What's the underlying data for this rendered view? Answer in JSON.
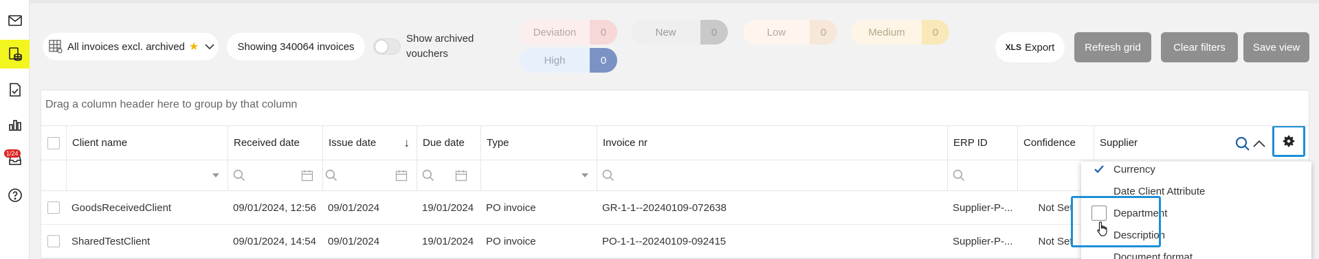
{
  "sidebar": {
    "items": [
      {
        "icon": "mail-icon"
      },
      {
        "icon": "invoices-database-icon",
        "active": true
      },
      {
        "icon": "document-check-icon"
      },
      {
        "icon": "bar-chart-icon"
      },
      {
        "icon": "inbox-icon",
        "badge": "1/24"
      },
      {
        "icon": "help-icon"
      }
    ]
  },
  "toolbar": {
    "view_label": "All invoices excl. archived",
    "showing": "Showing 340064 invoices",
    "toggle_label": "Show archived vouchers",
    "chips": [
      {
        "label": "Deviation",
        "count": "0",
        "bg": "#fdeeee",
        "count_bg": "#f6d8d8",
        "color": "#b8a4a4"
      },
      {
        "label": "New",
        "count": "0",
        "bg": "#efefef",
        "count_bg": "#c9c9c9",
        "color": "#9a9a9a"
      },
      {
        "label": "Low",
        "count": "0",
        "bg": "#fdf5ee",
        "count_bg": "#f7e7d9",
        "color": "#b7a99d"
      },
      {
        "label": "Medium",
        "count": "0",
        "bg": "#fdf6e6",
        "count_bg": "#f9e8b8",
        "color": "#b3a88c"
      },
      {
        "label": "High",
        "count": "0",
        "bg": "#e7f0fb",
        "count_bg": "#7a93c4",
        "color": "#9aa6b8"
      }
    ],
    "xls_label": "Export",
    "xls_prefix": "XLS",
    "refresh_label": "Refresh grid",
    "clear_label": "Clear filters",
    "save_label": "Save view"
  },
  "grid": {
    "group_hint": "Drag a column header here to group by that column",
    "columns": [
      "Client name",
      "Received date",
      "Issue date",
      "Due date",
      "Type",
      "Invoice nr",
      "ERP ID",
      "Confidence",
      "Supplier"
    ],
    "rows": [
      {
        "client": "GoodsReceivedClient",
        "received": "09/01/2024, 12:56",
        "issue": "09/01/2024",
        "due": "19/01/2024",
        "type": "PO invoice",
        "invoice": "GR-1-1--20240109-072638",
        "erp": "Supplier-P-...",
        "confidence": "Not Set"
      },
      {
        "client": "SharedTestClient",
        "received": "09/01/2024, 14:54",
        "issue": "09/01/2024",
        "due": "19/01/2024",
        "type": "PO invoice",
        "invoice": "PO-1-1--20240109-092415",
        "erp": "Supplier-P-...",
        "confidence": "Not Set"
      }
    ]
  },
  "column_chooser": {
    "options": [
      {
        "label": "Currency",
        "checked": true
      },
      {
        "label": "Date Client Attribute",
        "checked": false
      },
      {
        "label": "Department",
        "checked": false
      },
      {
        "label": "Description",
        "checked": false
      },
      {
        "label": "Document format",
        "checked": false
      }
    ]
  },
  "colors": {
    "accent": "#1b8fd6",
    "active_sidebar": "#f3f51e",
    "button_gray": "#8f8f8f"
  }
}
